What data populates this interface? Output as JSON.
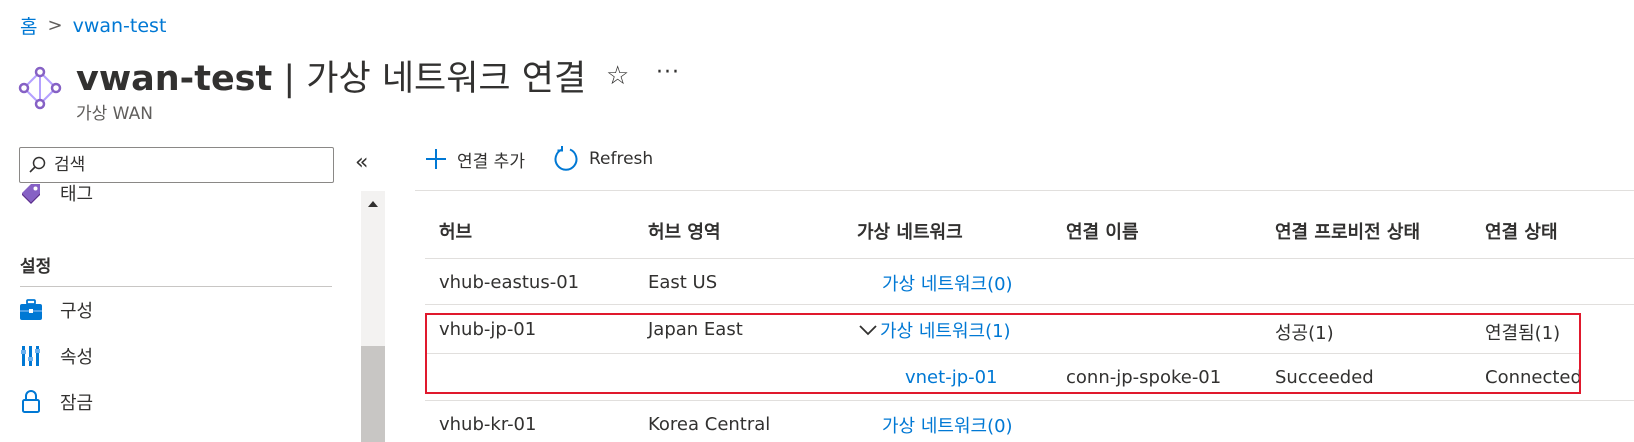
{
  "breadcrumb": {
    "home": "홈",
    "separator": ">",
    "current": "vwan-test"
  },
  "header": {
    "resource_name": "vwan-test",
    "separator": " | ",
    "page_name": "가상 네트워크 연결",
    "subtitle": "가상 WAN",
    "favorite_icon": "star-outline-icon",
    "more_label": "···"
  },
  "sidebar": {
    "search_placeholder": "검색",
    "collapse_label": "«",
    "items_top": [
      {
        "label": "태그",
        "icon": "tag-icon"
      }
    ],
    "section_title": "설정",
    "items": [
      {
        "label": "구성",
        "icon": "configuration-icon"
      },
      {
        "label": "속성",
        "icon": "properties-icon"
      },
      {
        "label": "잠금",
        "icon": "lock-icon"
      }
    ]
  },
  "toolbar": {
    "add_label": "연결 추가",
    "refresh_label": "Refresh"
  },
  "table": {
    "columns": [
      "허브",
      "허브 영역",
      "가상 네트워크",
      "연결 이름",
      "연결 프로비전 상태",
      "연결 상태"
    ],
    "rows": [
      {
        "hub": "vhub-eastus-01",
        "region": "East US",
        "vnet": "가상 네트워크(0)",
        "conn_name": "",
        "prov_state": "",
        "conn_state": ""
      },
      {
        "hub": "vhub-jp-01",
        "region": "Japan East",
        "vnet": "가상 네트워크(1)",
        "conn_name": "",
        "prov_state": "성공(1)",
        "conn_state": "연결됨(1)",
        "expanded": true
      },
      {
        "hub": "",
        "region": "",
        "vnet": "vnet-jp-01",
        "conn_name": "conn-jp-spoke-01",
        "prov_state": "Succeeded",
        "conn_state": "Connected"
      },
      {
        "hub": "vhub-kr-01",
        "region": "Korea Central",
        "vnet": "가상 네트워크(0)",
        "conn_name": "",
        "prov_state": "",
        "conn_state": ""
      }
    ]
  },
  "colors": {
    "link": "#0078d4",
    "highlight_border": "#e0192d",
    "text": "#323130"
  }
}
